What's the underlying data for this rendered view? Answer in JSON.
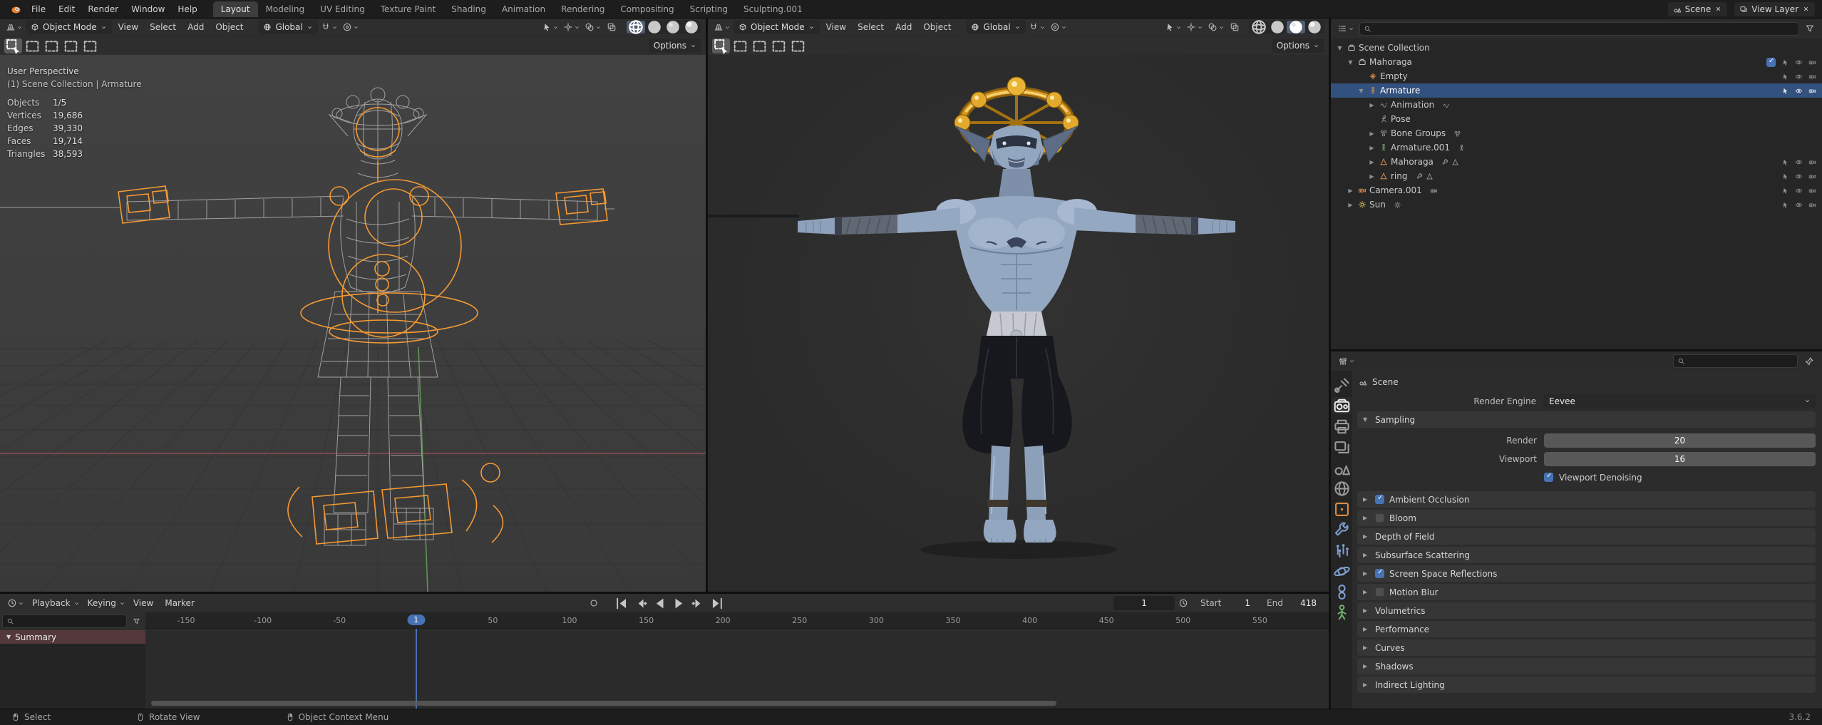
{
  "topbar": {
    "menus": [
      "File",
      "Edit",
      "Render",
      "Window",
      "Help"
    ],
    "workspaces": [
      "Layout",
      "Modeling",
      "UV Editing",
      "Texture Paint",
      "Shading",
      "Animation",
      "Rendering",
      "Compositing",
      "Scripting",
      "Sculpting.001"
    ],
    "active_workspace": "Layout",
    "scene_selector": {
      "value": "Scene"
    },
    "view_layer_selector": {
      "value": "View Layer"
    }
  },
  "viewports": {
    "shading_modes": [
      "wireframe",
      "solid",
      "material-preview",
      "rendered"
    ],
    "left": {
      "mode": "Object Mode",
      "menus": [
        "View",
        "Select",
        "Add",
        "Object"
      ],
      "orientation": "Global",
      "options_label": "Options",
      "active_shading": 0,
      "overlay": {
        "view_name": "User Perspective",
        "context": "(1) Scene Collection | Armature",
        "stats": [
          {
            "label": "Objects",
            "value": "1/5"
          },
          {
            "label": "Vertices",
            "value": "19,686"
          },
          {
            "label": "Edges",
            "value": "39,330"
          },
          {
            "label": "Faces",
            "value": "19,714"
          },
          {
            "label": "Triangles",
            "value": "38,593"
          }
        ]
      }
    },
    "right": {
      "mode": "Object Mode",
      "menus": [
        "View",
        "Select",
        "Add",
        "Object"
      ],
      "orientation": "Global",
      "options_label": "Options",
      "active_shading": 2
    }
  },
  "outliner": {
    "rows": [
      {
        "label": "Scene Collection",
        "icon": "scenecollection",
        "depth": 0,
        "expander": "open",
        "controls": "none"
      },
      {
        "label": "Mahoraga",
        "icon": "collection",
        "depth": 1,
        "expander": "open",
        "controls": "collection"
      },
      {
        "label": "Empty",
        "icon": "empty",
        "depth": 2,
        "expander": "none",
        "controls": "object"
      },
      {
        "label": "Armature",
        "icon": "armature",
        "depth": 2,
        "expander": "open",
        "controls": "object",
        "selected": true
      },
      {
        "label": "Animation",
        "icon": "animation",
        "depth": 3,
        "expander": "closed",
        "controls": "none",
        "trailing": [
          "animation"
        ]
      },
      {
        "label": "Pose",
        "icon": "pose",
        "depth": 3,
        "expander": "none",
        "controls": "none"
      },
      {
        "label": "Bone Groups",
        "icon": "bonegroups",
        "depth": 3,
        "expander": "closed",
        "controls": "none",
        "trailing": [
          "bonegroups"
        ]
      },
      {
        "label": "Armature.001",
        "icon": "armaturedata",
        "depth": 3,
        "expander": "closed",
        "controls": "none",
        "trailing": [
          "armature"
        ]
      },
      {
        "label": "Mahoraga",
        "icon": "mesh",
        "depth": 3,
        "expander": "closed",
        "controls": "object",
        "trailing": [
          "modifier",
          "mesh"
        ]
      },
      {
        "label": "ring",
        "icon": "mesh",
        "depth": 3,
        "expander": "closed",
        "controls": "object",
        "trailing": [
          "modifier",
          "mesh"
        ]
      },
      {
        "label": "Camera.001",
        "icon": "cameraicon",
        "depth": 1,
        "expander": "closed",
        "controls": "object",
        "trailing": [
          "cameraicon"
        ]
      },
      {
        "label": "Sun",
        "icon": "light",
        "depth": 1,
        "expander": "closed",
        "controls": "object",
        "trailing": [
          "light"
        ]
      }
    ]
  },
  "properties": {
    "tabs": [
      {
        "name": "tool"
      },
      {
        "name": "render",
        "active": true
      },
      {
        "name": "output"
      },
      {
        "name": "view-layer"
      },
      {
        "name": "scene"
      },
      {
        "name": "world"
      },
      {
        "name": "object"
      },
      {
        "name": "modifiers"
      },
      {
        "name": "particles"
      },
      {
        "name": "physics"
      },
      {
        "name": "constraints"
      },
      {
        "name": "data"
      }
    ],
    "breadcrumb": "Scene",
    "render_engine_label": "Render Engine",
    "render_engine_value": "Eevee",
    "sampling": {
      "label": "Sampling",
      "rows": [
        {
          "label": "Render",
          "value": "20"
        },
        {
          "label": "Viewport",
          "value": "16"
        }
      ],
      "checkbox": {
        "label": "Viewport Denoising",
        "checked": true
      }
    },
    "panels": [
      {
        "label": "Ambient Occlusion",
        "checkbox": true,
        "checked": true
      },
      {
        "label": "Bloom",
        "checkbox": true,
        "checked": false
      },
      {
        "label": "Depth of Field",
        "checkbox": false
      },
      {
        "label": "Subsurface Scattering",
        "checkbox": false
      },
      {
        "label": "Screen Space Reflections",
        "checkbox": true,
        "checked": true
      },
      {
        "label": "Motion Blur",
        "checkbox": true,
        "checked": false
      },
      {
        "label": "Volumetrics",
        "checkbox": false
      },
      {
        "label": "Performance",
        "checkbox": false
      },
      {
        "label": "Curves",
        "checkbox": false
      },
      {
        "label": "Shadows",
        "checkbox": false
      },
      {
        "label": "Indirect Lighting",
        "checkbox": false
      }
    ]
  },
  "timeline": {
    "menus": [
      "Playback",
      "Keying",
      "View",
      "Marker"
    ],
    "current_frame": "1",
    "start_label": "Start",
    "start_value": "1",
    "end_label": "End",
    "end_value": "418",
    "ruler_labels": [
      "-150",
      "-100",
      "-50",
      "50",
      "100",
      "150",
      "200",
      "250",
      "300",
      "350",
      "400",
      "450",
      "500",
      "550"
    ],
    "summary_label": "Summary"
  },
  "statusbar": {
    "items": [
      {
        "icon": "mouse-left",
        "label": "Select"
      },
      {
        "icon": "mouse-middle",
        "label": "Rotate View"
      },
      {
        "icon": "mouse-right",
        "label": "Object Context Menu"
      }
    ],
    "version": "3.6.2",
    "accent_color": "#4772b3",
    "selection_color": "#ff9e33"
  }
}
